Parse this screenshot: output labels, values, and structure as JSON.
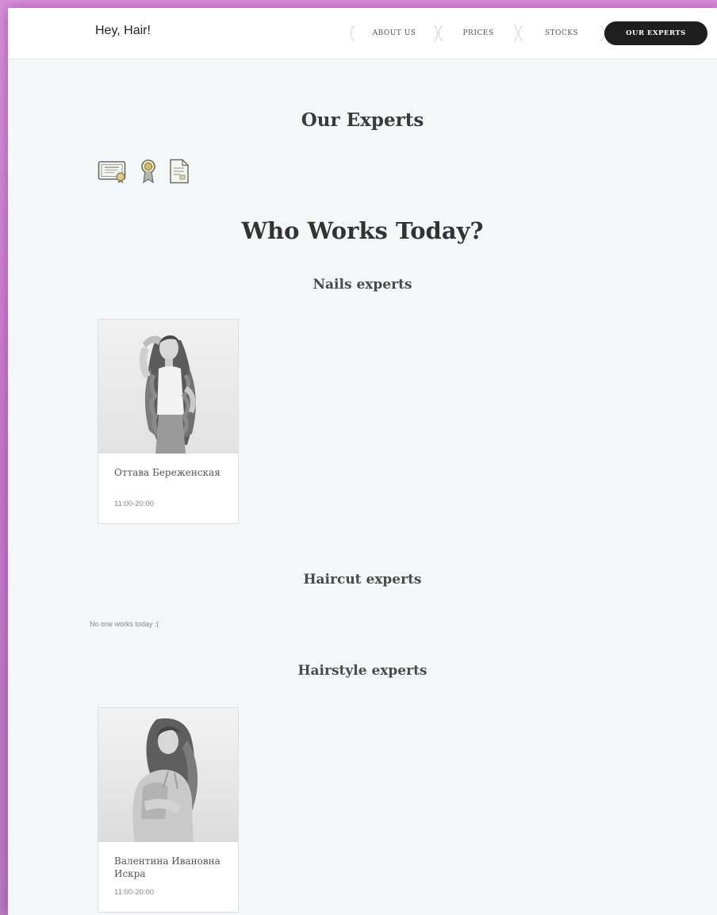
{
  "header": {
    "logo": "Hey, Hair!",
    "nav": [
      {
        "label": "ABOUT US"
      },
      {
        "label": "PRICES"
      },
      {
        "label": "STOCKS"
      },
      {
        "label": "OUR EXPERTS",
        "active": true
      }
    ]
  },
  "page_title": "Our Experts",
  "certificates": [
    "certificate-icon",
    "award-ribbon-icon",
    "document-icon"
  ],
  "who_title": "Who Works Today?",
  "sections": [
    {
      "title": "Nails experts",
      "experts": [
        {
          "name": "Оттава Береженская",
          "hours": "11:00-20:00"
        }
      ]
    },
    {
      "title": "Haircut experts",
      "empty_message": "No one works today :(",
      "experts": []
    },
    {
      "title": "Hairstyle experts",
      "experts": [
        {
          "name": "Валентина Ивановна Искра",
          "hours": "11:00-20:00"
        }
      ]
    }
  ],
  "colors": {
    "accent_dark": "#1e1e1e",
    "page_background": "#f4f7f8",
    "outer_background": "#d890d8"
  }
}
